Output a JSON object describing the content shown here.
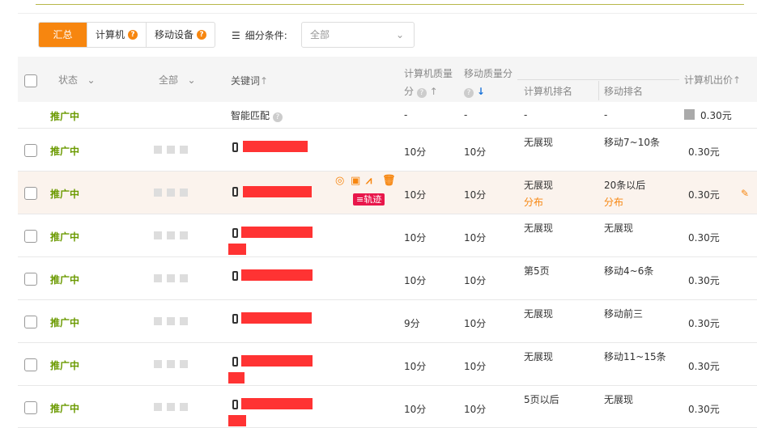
{
  "tabs": [
    {
      "label": "汇总",
      "active": true
    },
    {
      "label": "计算机",
      "help": "?"
    },
    {
      "label": "移动设备",
      "help": "?"
    }
  ],
  "filter": {
    "label": "细分条件:",
    "value": "全部"
  },
  "header": {
    "status": "状态",
    "all": "全部",
    "keyword": "关键词",
    "pc_quality_1": "计算机质量",
    "pc_quality_2": "分",
    "mobile_quality": "移动质量分",
    "pc_rank": "计算机排名",
    "mobile_rank": "移动排名",
    "pc_bid": "计算机出价"
  },
  "smart_row": {
    "status": "推广中",
    "keyword": "智能匹配",
    "pc_quality": "-",
    "mobile_quality": "-",
    "pc_rank": "-",
    "mobile_rank": "-",
    "bid": "0.30元"
  },
  "rows": [
    {
      "status": "推广中",
      "pc_quality": "10分",
      "mobile_quality": "10分",
      "pc_rank": "无展现",
      "mobile_rank": "移动7~10条",
      "bid": "0.30元"
    },
    {
      "status": "推广中",
      "pc_quality": "10分",
      "mobile_quality": "10分",
      "pc_rank": "无展现",
      "pc_rank_link": "分布",
      "mobile_rank": "20条以后",
      "mobile_rank_link": "分布",
      "bid": "0.30元",
      "track": "轨迹"
    },
    {
      "status": "推广中",
      "pc_quality": "10分",
      "mobile_quality": "10分",
      "pc_rank": "无展现",
      "mobile_rank": "无展现",
      "bid": "0.30元"
    },
    {
      "status": "推广中",
      "pc_quality": "10分",
      "mobile_quality": "10分",
      "pc_rank": "第5页",
      "mobile_rank": "移动4~6条",
      "bid": "0.30元"
    },
    {
      "status": "推广中",
      "pc_quality": "9分",
      "mobile_quality": "10分",
      "pc_rank": "无展现",
      "mobile_rank": "移动前三",
      "bid": "0.30元"
    },
    {
      "status": "推广中",
      "pc_quality": "10分",
      "mobile_quality": "10分",
      "pc_rank": "无展现",
      "mobile_rank": "移动11~15条",
      "bid": "0.30元"
    },
    {
      "status": "推广中",
      "pc_quality": "10分",
      "mobile_quality": "10分",
      "pc_rank": "5页以后",
      "mobile_rank": "无展现",
      "bid": "0.30元"
    }
  ]
}
